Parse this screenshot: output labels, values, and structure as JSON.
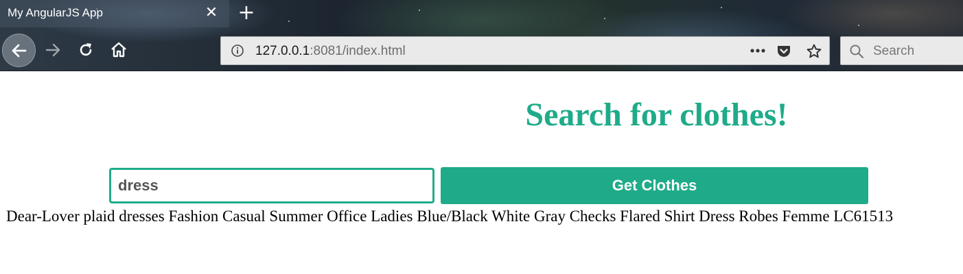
{
  "browser": {
    "tab": {
      "title": "My AngularJS App",
      "close_glyph": "✕"
    },
    "new_tab_glyph": "+",
    "nav": {
      "back_icon": "arrow-left-icon",
      "forward_icon": "arrow-right-icon",
      "reload_icon": "reload-icon",
      "home_icon": "home-icon"
    },
    "url": {
      "host": "127.0.0.1",
      "rest": ":8081/index.html"
    },
    "url_icons": [
      "info-icon",
      "more-icon",
      "pocket-icon",
      "bookmark-star-icon"
    ],
    "search": {
      "placeholder": "Search",
      "icon": "search-icon"
    }
  },
  "page": {
    "title": "Search for clothes!",
    "search_input": {
      "value": "dress"
    },
    "get_button_label": "Get Clothes",
    "results": [
      "Dear-Lover plaid dresses Fashion Casual Summer Office Ladies Blue/Black White Gray Checks Flared Shirt Dress Robes Femme LC61513"
    ]
  },
  "colors": {
    "accent": "#1fab89",
    "text": "#000000",
    "chrome_text": "#ffffff"
  }
}
